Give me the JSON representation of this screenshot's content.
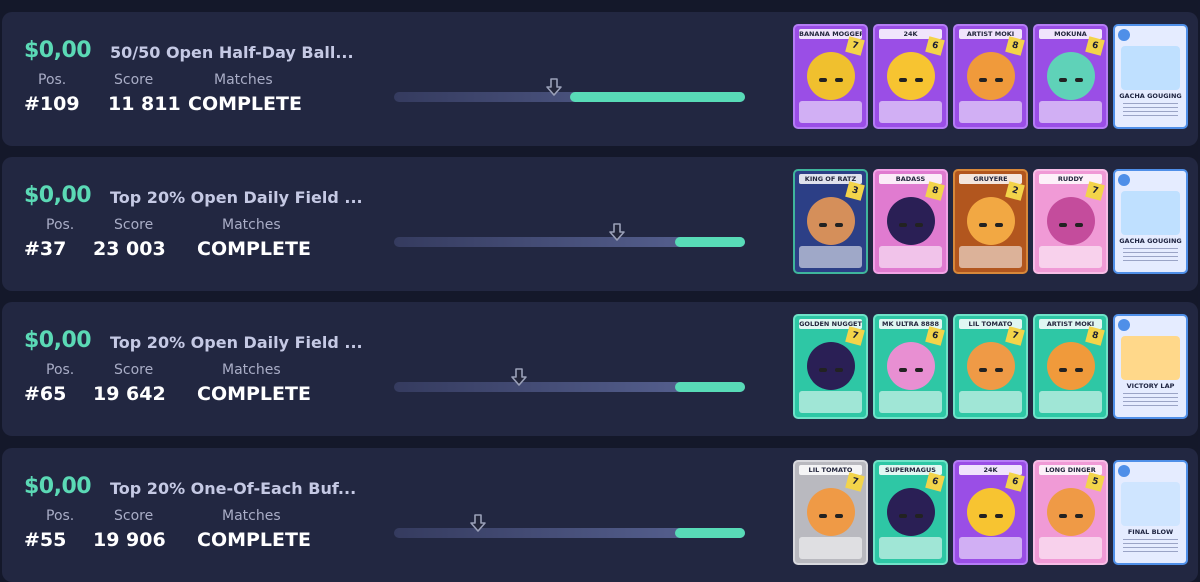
{
  "labels": {
    "pos": "Pos.",
    "score": "Score",
    "matches": "Matches"
  },
  "entries": [
    {
      "prize": "$0,00",
      "title": "50/50 Open Half-Day Ball...",
      "pos": "#109",
      "score": "11 811",
      "matches": "COMPLETE",
      "progress_fill": 0.5,
      "marker_position": 0.455,
      "cards": [
        {
          "name": "BANANA MOGGER",
          "rank": "7",
          "bg": "#9a4ee6",
          "border": "#b57cf6",
          "blob": "#f0c02e"
        },
        {
          "name": "24K",
          "rank": "6",
          "bg": "#9a4ee6",
          "border": "#b57cf6",
          "blob": "#f7c431"
        },
        {
          "name": "ARTIST MOKI",
          "rank": "8",
          "bg": "#9a4ee6",
          "border": "#b57cf6",
          "blob": "#f09a3b"
        },
        {
          "name": "MOKUNA",
          "rank": "6",
          "bg": "#9a4ee6",
          "border": "#b57cf6",
          "blob": "#5fd2b8"
        }
      ],
      "special": {
        "name": "GACHA GOUGING",
        "art": "#bfe0ff"
      }
    },
    {
      "prize": "$0,00",
      "title": "Top 20% Open Daily Field ...",
      "pos": "#37",
      "score": "23 003",
      "matches": "COMPLETE",
      "progress_fill": 0.2,
      "marker_position": 0.635,
      "cards": [
        {
          "name": "KING OF RATZ",
          "rank": "3",
          "bg": "#2c3f86",
          "border": "#3fb59c",
          "blob": "#d58f5a"
        },
        {
          "name": "BADASS",
          "rank": "8",
          "bg": "#e07bd0",
          "border": "#f2a3e6",
          "blob": "#2a1f55"
        },
        {
          "name": "GRUYERE",
          "rank": "2",
          "bg": "#b2561e",
          "border": "#d8883a",
          "blob": "#f2a843"
        },
        {
          "name": "RUDDY",
          "rank": "7",
          "bg": "#f09ad6",
          "border": "#f7bde6",
          "blob": "#c44c9c"
        }
      ],
      "special": {
        "name": "GACHA GOUGING",
        "art": "#bfe0ff"
      }
    },
    {
      "prize": "$0,00",
      "title": "Top 20% Open Daily Field ...",
      "pos": "#65",
      "score": "19 642",
      "matches": "COMPLETE",
      "progress_fill": 0.2,
      "marker_position": 0.355,
      "cards": [
        {
          "name": "GOLDEN NUGGET",
          "rank": "7",
          "bg": "#2ec7a5",
          "border": "#6fe3c8",
          "blob": "#2a1f55"
        },
        {
          "name": "MK ULTRA 8888",
          "rank": "6",
          "bg": "#2ec7a5",
          "border": "#6fe3c8",
          "blob": "#e88fd2"
        },
        {
          "name": "LIL TOMATO",
          "rank": "7",
          "bg": "#2ec7a5",
          "border": "#6fe3c8",
          "blob": "#ef9a46"
        },
        {
          "name": "ARTIST MOKI",
          "rank": "8",
          "bg": "#2ec7a5",
          "border": "#6fe3c8",
          "blob": "#f09a3b"
        }
      ],
      "special": {
        "name": "VICTORY LAP",
        "art": "#ffd88a"
      }
    },
    {
      "prize": "$0,00",
      "title": "Top 20% One-Of-Each Buf...",
      "pos": "#55",
      "score": "19 906",
      "matches": "COMPLETE",
      "progress_fill": 0.2,
      "marker_position": 0.24,
      "cards": [
        {
          "name": "LIL TOMATO",
          "rank": "7",
          "bg": "#b9b9bf",
          "border": "#d9d9de",
          "blob": "#ef9a46"
        },
        {
          "name": "SUPERMAGUS",
          "rank": "6",
          "bg": "#2ec7a5",
          "border": "#6fe3c8",
          "blob": "#2a1f55"
        },
        {
          "name": "24K",
          "rank": "6",
          "bg": "#9a4ee6",
          "border": "#b57cf6",
          "blob": "#f7c431"
        },
        {
          "name": "LONG DINGER",
          "rank": "5",
          "bg": "#f09ad6",
          "border": "#f7bde6",
          "blob": "#ef9a46"
        }
      ],
      "special": {
        "name": "FINAL BLOW",
        "art": "#cfe5ff"
      }
    }
  ]
}
